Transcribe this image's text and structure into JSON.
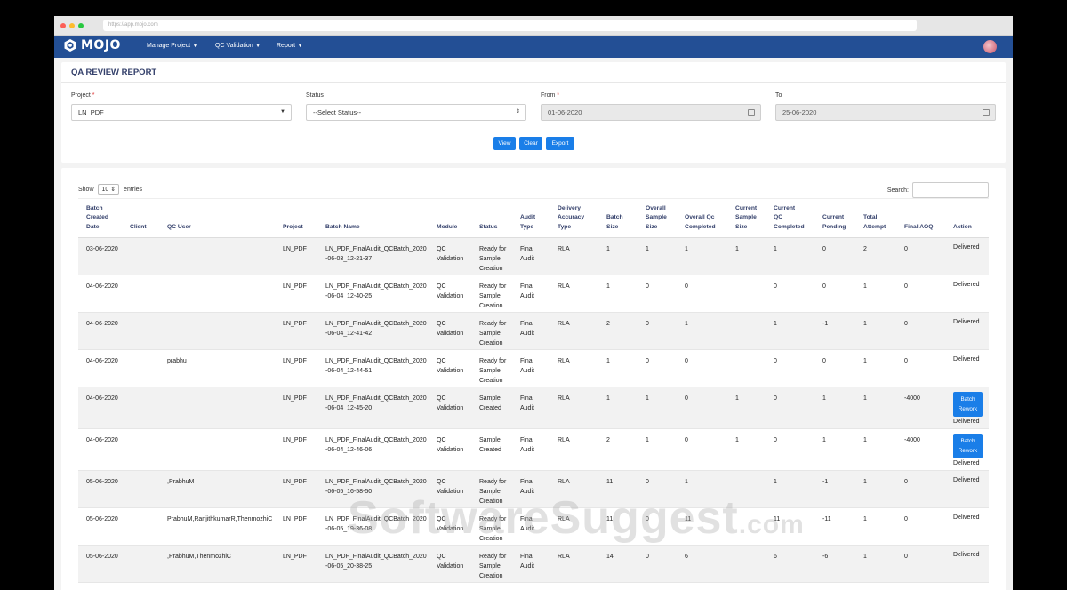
{
  "browser": {
    "url": "https://app.mojo.com"
  },
  "nav": {
    "logo": "MOJO",
    "menus": [
      "Manage Project",
      "QC Validation",
      "Report"
    ]
  },
  "page": {
    "title": "QA REVIEW REPORT"
  },
  "filters": {
    "project_label": "Project",
    "project_value": "LN_PDF",
    "status_label": "Status",
    "status_value": "--Select Status--",
    "from_label": "From",
    "from_value": "01-06-2020",
    "to_label": "To",
    "to_value": "25-06-2020",
    "required_mark": "*"
  },
  "buttons": {
    "view": "View",
    "clear": "Clear",
    "export": "Export"
  },
  "table_controls": {
    "show_label": "Show",
    "entries_value": "10",
    "entries_label": "entries",
    "search_label": "Search:"
  },
  "columns": [
    "Batch\nCreated\nDate",
    "Client",
    "QC User",
    "Project",
    "Batch Name",
    "Module",
    "Status",
    "Audit\nType",
    "Delivery\nAccuracy\nType",
    "Batch\nSize",
    "Overall\nSample\nSize",
    "Overall Qc\nCompleted",
    "Current\nSample\nSize",
    "Current\nQC\nCompleted",
    "Current\nPending",
    "Total\nAttempt",
    "Final AOQ",
    "Action"
  ],
  "rows": [
    {
      "date": "03-06-2020",
      "client": "",
      "qc_user": "",
      "project": "LN_PDF",
      "batch_l1": "LN_PDF_FinalAudit_QCBatch_2020",
      "batch_l2": "-06-03_12-21-37",
      "module": "QC\nValidation",
      "status": "Ready for\nSample\nCreation",
      "audit": "Final\nAudit",
      "accuracy": "RLA",
      "batch_size": "1",
      "overall_sample": "1",
      "overall_qc": "1",
      "current_sample": "1",
      "current_qc": "1",
      "pending": "0",
      "attempt": "2",
      "aoq": "0",
      "rework": "",
      "action": "Delivered"
    },
    {
      "date": "04-06-2020",
      "client": "",
      "qc_user": "",
      "project": "LN_PDF",
      "batch_l1": "LN_PDF_FinalAudit_QCBatch_2020",
      "batch_l2": "-06-04_12-40-25",
      "module": "QC\nValidation",
      "status": "Ready for\nSample\nCreation",
      "audit": "Final\nAudit",
      "accuracy": "RLA",
      "batch_size": "1",
      "overall_sample": "0",
      "overall_qc": "0",
      "current_sample": "",
      "current_qc": "0",
      "pending": "0",
      "attempt": "1",
      "aoq": "0",
      "rework": "",
      "action": "Delivered"
    },
    {
      "date": "04-06-2020",
      "client": "",
      "qc_user": "",
      "project": "LN_PDF",
      "batch_l1": "LN_PDF_FinalAudit_QCBatch_2020",
      "batch_l2": "-06-04_12-41-42",
      "module": "QC\nValidation",
      "status": "Ready for\nSample\nCreation",
      "audit": "Final\nAudit",
      "accuracy": "RLA",
      "batch_size": "2",
      "overall_sample": "0",
      "overall_qc": "1",
      "current_sample": "",
      "current_qc": "1",
      "pending": "-1",
      "attempt": "1",
      "aoq": "0",
      "rework": "",
      "action": "Delivered"
    },
    {
      "date": "04-06-2020",
      "client": "",
      "qc_user": "prabhu",
      "project": "LN_PDF",
      "batch_l1": "LN_PDF_FinalAudit_QCBatch_2020",
      "batch_l2": "-06-04_12-44-51",
      "module": "QC\nValidation",
      "status": "Ready for\nSample\nCreation",
      "audit": "Final\nAudit",
      "accuracy": "RLA",
      "batch_size": "1",
      "overall_sample": "0",
      "overall_qc": "0",
      "current_sample": "",
      "current_qc": "0",
      "pending": "0",
      "attempt": "1",
      "aoq": "0",
      "rework": "",
      "action": "Delivered"
    },
    {
      "date": "04-06-2020",
      "client": "",
      "qc_user": "",
      "project": "LN_PDF",
      "batch_l1": "LN_PDF_FinalAudit_QCBatch_2020",
      "batch_l2": "-06-04_12-45-20",
      "module": "QC\nValidation",
      "status": "Sample\nCreated",
      "audit": "Final\nAudit",
      "accuracy": "RLA",
      "batch_size": "1",
      "overall_sample": "1",
      "overall_qc": "0",
      "current_sample": "1",
      "current_qc": "0",
      "pending": "1",
      "attempt": "1",
      "aoq": "-4000",
      "rework": "Batch\nRework",
      "action": "Delivered"
    },
    {
      "date": "04-06-2020",
      "client": "",
      "qc_user": "",
      "project": "LN_PDF",
      "batch_l1": "LN_PDF_FinalAudit_QCBatch_2020",
      "batch_l2": "-06-04_12-46-06",
      "module": "QC\nValidation",
      "status": "Sample\nCreated",
      "audit": "Final\nAudit",
      "accuracy": "RLA",
      "batch_size": "2",
      "overall_sample": "1",
      "overall_qc": "0",
      "current_sample": "1",
      "current_qc": "0",
      "pending": "1",
      "attempt": "1",
      "aoq": "-4000",
      "rework": "Batch\nRework",
      "action": "Delivered"
    },
    {
      "date": "05-06-2020",
      "client": "",
      "qc_user": ",PrabhuM",
      "project": "LN_PDF",
      "batch_l1": "LN_PDF_FinalAudit_QCBatch_2020",
      "batch_l2": "-06-05_16-58-50",
      "module": "QC\nValidation",
      "status": "Ready for\nSample\nCreation",
      "audit": "Final\nAudit",
      "accuracy": "RLA",
      "batch_size": "11",
      "overall_sample": "0",
      "overall_qc": "1",
      "current_sample": "",
      "current_qc": "1",
      "pending": "-1",
      "attempt": "1",
      "aoq": "0",
      "rework": "",
      "action": "Delivered"
    },
    {
      "date": "05-06-2020",
      "client": "",
      "qc_user": "PrabhuM,RanjithkumarR,ThenmozhiC",
      "project": "LN_PDF",
      "batch_l1": "LN_PDF_FinalAudit_QCBatch_2020",
      "batch_l2": "-06-05_19-36-08",
      "module": "QC\nValidation",
      "status": "Ready for\nSample\nCreation",
      "audit": "Final\nAudit",
      "accuracy": "RLA",
      "batch_size": "11",
      "overall_sample": "0",
      "overall_qc": "11",
      "current_sample": "",
      "current_qc": "11",
      "pending": "-11",
      "attempt": "1",
      "aoq": "0",
      "rework": "",
      "action": "Delivered"
    },
    {
      "date": "05-06-2020",
      "client": "",
      "qc_user": ",PrabhuM,ThenmozhiC",
      "project": "LN_PDF",
      "batch_l1": "LN_PDF_FinalAudit_QCBatch_2020",
      "batch_l2": "-06-05_20-38-25",
      "module": "QC\nValidation",
      "status": "Ready for\nSample\nCreation",
      "audit": "Final\nAudit",
      "accuracy": "RLA",
      "batch_size": "14",
      "overall_sample": "0",
      "overall_qc": "6",
      "current_sample": "",
      "current_qc": "6",
      "pending": "-6",
      "attempt": "1",
      "aoq": "0",
      "rework": "",
      "action": "Delivered"
    }
  ],
  "watermark": {
    "main": "SoftwareSuggest",
    "suffix": ".com"
  },
  "colors": {
    "navbar": "#234f95",
    "button": "#1a7ee8",
    "heading": "#34406b"
  }
}
